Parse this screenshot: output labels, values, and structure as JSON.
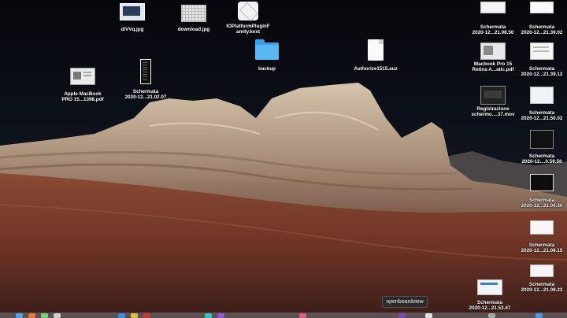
{
  "wallpaper": {
    "sky": "#0a0d14",
    "rock_light": "#c9b49e",
    "rock_dark": "#5a3b2c",
    "sand": "#7a3b2a"
  },
  "desktop_items": [
    {
      "id": "divvq",
      "name": "dIVVq.jpg",
      "icon": "screenshot-thumbnail-icon"
    },
    {
      "id": "download",
      "name": "download.jpg",
      "icon": "keyboard-image-icon"
    },
    {
      "id": "ioplatform",
      "line1": "IOPlatformPluginF",
      "line2": "amily.kext",
      "icon": "kext-package-icon"
    },
    {
      "id": "backup",
      "name": "backup",
      "icon": "folder-icon"
    },
    {
      "id": "authorize",
      "name": "Authorize1515.auz",
      "icon": "document-icon"
    },
    {
      "id": "apple",
      "line1": "Apple MacBook",
      "line2": "PRO 15...1398.pdf",
      "icon": "pdf-document-icon"
    },
    {
      "id": "schermata_left",
      "line1": "Schermata",
      "line2": "2020-12...21.02.07",
      "icon": "screenshot-thumbnail-icon"
    },
    {
      "id": "r1",
      "line1": "Schermata",
      "line2": "2020-12...21.08.50",
      "icon": "screenshot-thumbnail-icon"
    },
    {
      "id": "r2",
      "line1": "Schermata",
      "line2": "2020-12...21.39.02",
      "icon": "screenshot-thumbnail-icon"
    },
    {
      "id": "r3",
      "line1": "Macbook Pro 15",
      "line2": "Retina A...atic.pdf",
      "icon": "pdf-document-icon"
    },
    {
      "id": "r4",
      "line1": "Schermata",
      "line2": "2020-12...21.39.12",
      "icon": "screenshot-thumbnail-icon"
    },
    {
      "id": "r5",
      "line1": "Registrazione",
      "line2": "schermo....37.mov",
      "icon": "video-thumbnail-icon"
    },
    {
      "id": "r6",
      "line1": "Schermata",
      "line2": "2020-12...21.50.02",
      "icon": "screenshot-thumbnail-icon"
    },
    {
      "id": "r7",
      "line1": "Schermata",
      "line2": "2020-12....0.59.58",
      "icon": "screenshot-thumbnail-icon"
    },
    {
      "id": "r8",
      "line1": "Schermata",
      "line2": "2020-12...21.04.30",
      "icon": "screenshot-thumbnail-icon"
    },
    {
      "id": "r9",
      "line1": "Schermata",
      "line2": "2020-12...21.08.15",
      "icon": "screenshot-thumbnail-icon"
    },
    {
      "id": "r10",
      "line1": "Schermata",
      "line2": "2020-12...21.08.23",
      "icon": "screenshot-thumbnail-icon"
    },
    {
      "id": "r11",
      "line1": "Schermata",
      "line2": "2020-12...21.53.47",
      "icon": "screenshot-thumbnail-icon"
    }
  ],
  "tooltip": {
    "text": "openboardview"
  }
}
